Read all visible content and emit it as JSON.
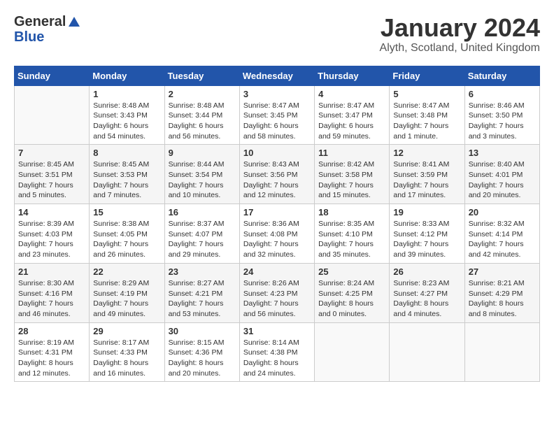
{
  "header": {
    "logo_general": "General",
    "logo_blue": "Blue",
    "month_title": "January 2024",
    "location": "Alyth, Scotland, United Kingdom"
  },
  "weekdays": [
    "Sunday",
    "Monday",
    "Tuesday",
    "Wednesday",
    "Thursday",
    "Friday",
    "Saturday"
  ],
  "weeks": [
    [
      {
        "day": "",
        "sunrise": "",
        "sunset": "",
        "daylight": ""
      },
      {
        "day": "1",
        "sunrise": "Sunrise: 8:48 AM",
        "sunset": "Sunset: 3:43 PM",
        "daylight": "Daylight: 6 hours and 54 minutes."
      },
      {
        "day": "2",
        "sunrise": "Sunrise: 8:48 AM",
        "sunset": "Sunset: 3:44 PM",
        "daylight": "Daylight: 6 hours and 56 minutes."
      },
      {
        "day": "3",
        "sunrise": "Sunrise: 8:47 AM",
        "sunset": "Sunset: 3:45 PM",
        "daylight": "Daylight: 6 hours and 58 minutes."
      },
      {
        "day": "4",
        "sunrise": "Sunrise: 8:47 AM",
        "sunset": "Sunset: 3:47 PM",
        "daylight": "Daylight: 6 hours and 59 minutes."
      },
      {
        "day": "5",
        "sunrise": "Sunrise: 8:47 AM",
        "sunset": "Sunset: 3:48 PM",
        "daylight": "Daylight: 7 hours and 1 minute."
      },
      {
        "day": "6",
        "sunrise": "Sunrise: 8:46 AM",
        "sunset": "Sunset: 3:50 PM",
        "daylight": "Daylight: 7 hours and 3 minutes."
      }
    ],
    [
      {
        "day": "7",
        "sunrise": "Sunrise: 8:45 AM",
        "sunset": "Sunset: 3:51 PM",
        "daylight": "Daylight: 7 hours and 5 minutes."
      },
      {
        "day": "8",
        "sunrise": "Sunrise: 8:45 AM",
        "sunset": "Sunset: 3:53 PM",
        "daylight": "Daylight: 7 hours and 7 minutes."
      },
      {
        "day": "9",
        "sunrise": "Sunrise: 8:44 AM",
        "sunset": "Sunset: 3:54 PM",
        "daylight": "Daylight: 7 hours and 10 minutes."
      },
      {
        "day": "10",
        "sunrise": "Sunrise: 8:43 AM",
        "sunset": "Sunset: 3:56 PM",
        "daylight": "Daylight: 7 hours and 12 minutes."
      },
      {
        "day": "11",
        "sunrise": "Sunrise: 8:42 AM",
        "sunset": "Sunset: 3:58 PM",
        "daylight": "Daylight: 7 hours and 15 minutes."
      },
      {
        "day": "12",
        "sunrise": "Sunrise: 8:41 AM",
        "sunset": "Sunset: 3:59 PM",
        "daylight": "Daylight: 7 hours and 17 minutes."
      },
      {
        "day": "13",
        "sunrise": "Sunrise: 8:40 AM",
        "sunset": "Sunset: 4:01 PM",
        "daylight": "Daylight: 7 hours and 20 minutes."
      }
    ],
    [
      {
        "day": "14",
        "sunrise": "Sunrise: 8:39 AM",
        "sunset": "Sunset: 4:03 PM",
        "daylight": "Daylight: 7 hours and 23 minutes."
      },
      {
        "day": "15",
        "sunrise": "Sunrise: 8:38 AM",
        "sunset": "Sunset: 4:05 PM",
        "daylight": "Daylight: 7 hours and 26 minutes."
      },
      {
        "day": "16",
        "sunrise": "Sunrise: 8:37 AM",
        "sunset": "Sunset: 4:07 PM",
        "daylight": "Daylight: 7 hours and 29 minutes."
      },
      {
        "day": "17",
        "sunrise": "Sunrise: 8:36 AM",
        "sunset": "Sunset: 4:08 PM",
        "daylight": "Daylight: 7 hours and 32 minutes."
      },
      {
        "day": "18",
        "sunrise": "Sunrise: 8:35 AM",
        "sunset": "Sunset: 4:10 PM",
        "daylight": "Daylight: 7 hours and 35 minutes."
      },
      {
        "day": "19",
        "sunrise": "Sunrise: 8:33 AM",
        "sunset": "Sunset: 4:12 PM",
        "daylight": "Daylight: 7 hours and 39 minutes."
      },
      {
        "day": "20",
        "sunrise": "Sunrise: 8:32 AM",
        "sunset": "Sunset: 4:14 PM",
        "daylight": "Daylight: 7 hours and 42 minutes."
      }
    ],
    [
      {
        "day": "21",
        "sunrise": "Sunrise: 8:30 AM",
        "sunset": "Sunset: 4:16 PM",
        "daylight": "Daylight: 7 hours and 46 minutes."
      },
      {
        "day": "22",
        "sunrise": "Sunrise: 8:29 AM",
        "sunset": "Sunset: 4:19 PM",
        "daylight": "Daylight: 7 hours and 49 minutes."
      },
      {
        "day": "23",
        "sunrise": "Sunrise: 8:27 AM",
        "sunset": "Sunset: 4:21 PM",
        "daylight": "Daylight: 7 hours and 53 minutes."
      },
      {
        "day": "24",
        "sunrise": "Sunrise: 8:26 AM",
        "sunset": "Sunset: 4:23 PM",
        "daylight": "Daylight: 7 hours and 56 minutes."
      },
      {
        "day": "25",
        "sunrise": "Sunrise: 8:24 AM",
        "sunset": "Sunset: 4:25 PM",
        "daylight": "Daylight: 8 hours and 0 minutes."
      },
      {
        "day": "26",
        "sunrise": "Sunrise: 8:23 AM",
        "sunset": "Sunset: 4:27 PM",
        "daylight": "Daylight: 8 hours and 4 minutes."
      },
      {
        "day": "27",
        "sunrise": "Sunrise: 8:21 AM",
        "sunset": "Sunset: 4:29 PM",
        "daylight": "Daylight: 8 hours and 8 minutes."
      }
    ],
    [
      {
        "day": "28",
        "sunrise": "Sunrise: 8:19 AM",
        "sunset": "Sunset: 4:31 PM",
        "daylight": "Daylight: 8 hours and 12 minutes."
      },
      {
        "day": "29",
        "sunrise": "Sunrise: 8:17 AM",
        "sunset": "Sunset: 4:33 PM",
        "daylight": "Daylight: 8 hours and 16 minutes."
      },
      {
        "day": "30",
        "sunrise": "Sunrise: 8:15 AM",
        "sunset": "Sunset: 4:36 PM",
        "daylight": "Daylight: 8 hours and 20 minutes."
      },
      {
        "day": "31",
        "sunrise": "Sunrise: 8:14 AM",
        "sunset": "Sunset: 4:38 PM",
        "daylight": "Daylight: 8 hours and 24 minutes."
      },
      {
        "day": "",
        "sunrise": "",
        "sunset": "",
        "daylight": ""
      },
      {
        "day": "",
        "sunrise": "",
        "sunset": "",
        "daylight": ""
      },
      {
        "day": "",
        "sunrise": "",
        "sunset": "",
        "daylight": ""
      }
    ]
  ]
}
